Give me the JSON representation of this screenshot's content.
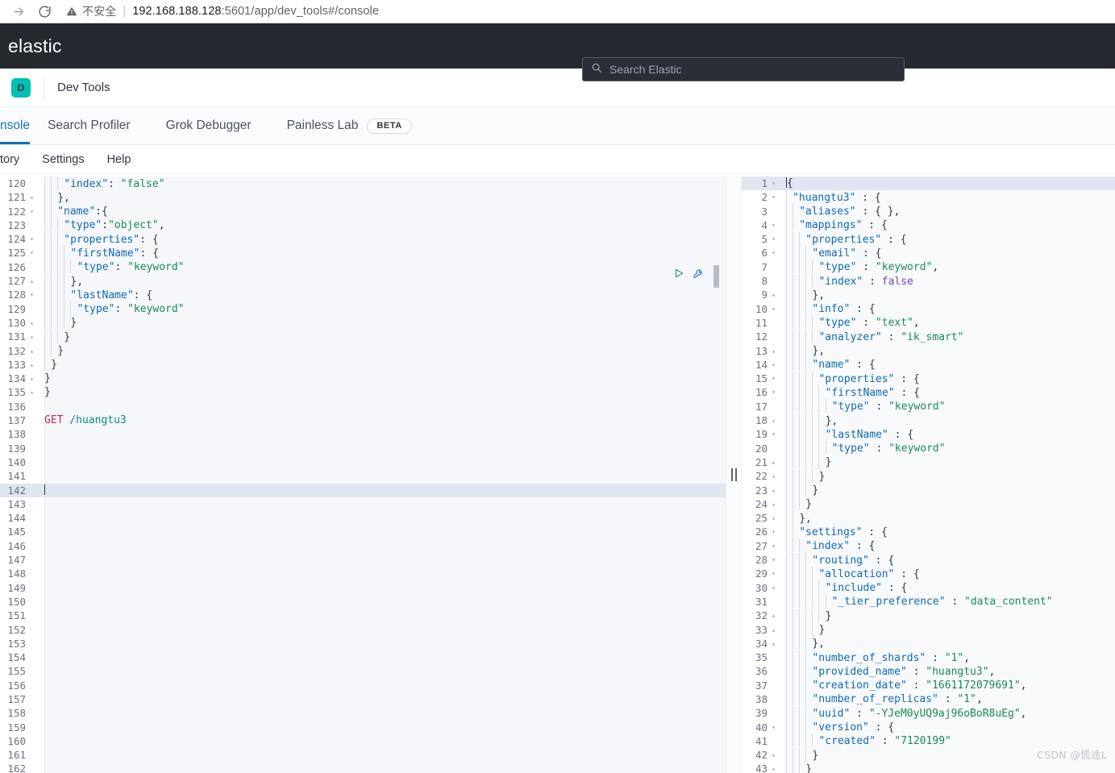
{
  "browser": {
    "forward_icon": "forward-arrow-icon",
    "reload_icon": "reload-icon",
    "security_icon": "warning-triangle-icon",
    "security_label": "不安全",
    "divider": "|",
    "url_host": "192.168.188.128",
    "url_rest": ":5601/app/dev_tools#/console"
  },
  "header": {
    "logo": "elastic",
    "search_placeholder": "Search Elastic",
    "search_value": "",
    "search_icon": "search-icon"
  },
  "app": {
    "badge": "D",
    "title": "Dev Tools"
  },
  "tabs": [
    {
      "label": "nsole",
      "full": "Console",
      "active": true,
      "beta": false
    },
    {
      "label": "Search Profiler",
      "active": false,
      "beta": false
    },
    {
      "label": "Grok Debugger",
      "active": false,
      "beta": false
    },
    {
      "label": "Painless Lab",
      "active": false,
      "beta": true,
      "beta_label": "BETA"
    }
  ],
  "submenu": [
    {
      "label": "tory",
      "full": "History"
    },
    {
      "label": "Settings"
    },
    {
      "label": "Help"
    }
  ],
  "request_editor": {
    "play_icon": "play-request-icon",
    "wrench_icon": "wrench-icon",
    "active_line": 142,
    "lines": [
      {
        "n": 120,
        "fold": "",
        "indent": 3,
        "code": "\"index\": \"false\"",
        "t": "kv_nocomma"
      },
      {
        "n": 121,
        "fold": "▴",
        "indent": 2,
        "code": "},"
      },
      {
        "n": 122,
        "fold": "▾",
        "indent": 2,
        "code": "\"name\":{"
      },
      {
        "n": 123,
        "fold": "",
        "indent": 3,
        "code": "\"type\":\"object\","
      },
      {
        "n": 124,
        "fold": "▾",
        "indent": 3,
        "code": "\"properties\": {"
      },
      {
        "n": 125,
        "fold": "▾",
        "indent": 4,
        "code": "\"firstName\": {"
      },
      {
        "n": 126,
        "fold": "",
        "indent": 5,
        "code": "\"type\": \"keyword\""
      },
      {
        "n": 127,
        "fold": "▴",
        "indent": 4,
        "code": "},"
      },
      {
        "n": 128,
        "fold": "▾",
        "indent": 4,
        "code": "\"lastName\": {"
      },
      {
        "n": 129,
        "fold": "",
        "indent": 5,
        "code": "\"type\": \"keyword\""
      },
      {
        "n": 130,
        "fold": "▴",
        "indent": 4,
        "code": "}"
      },
      {
        "n": 131,
        "fold": "▴",
        "indent": 3,
        "code": "}"
      },
      {
        "n": 132,
        "fold": "▴",
        "indent": 2,
        "code": "}"
      },
      {
        "n": 133,
        "fold": "▴",
        "indent": 1,
        "code": "}"
      },
      {
        "n": 134,
        "fold": "▴",
        "indent": 0,
        "code": "}"
      },
      {
        "n": 135,
        "fold": "▴",
        "indent": -1,
        "code": "}"
      },
      {
        "n": 136,
        "fold": "",
        "indent": -1,
        "code": ""
      },
      {
        "n": 137,
        "fold": "",
        "indent": -1,
        "code": "GET /huangtu3",
        "t": "request"
      },
      {
        "n": 138,
        "fold": "",
        "indent": -1,
        "code": ""
      },
      {
        "n": 139,
        "fold": "",
        "indent": -1,
        "code": ""
      },
      {
        "n": 140,
        "fold": "",
        "indent": -1,
        "code": ""
      },
      {
        "n": 141,
        "fold": "",
        "indent": -1,
        "code": ""
      },
      {
        "n": 142,
        "fold": "",
        "indent": -1,
        "code": "",
        "t": "cursor"
      },
      {
        "n": 143,
        "fold": "",
        "indent": -1,
        "code": ""
      },
      {
        "n": 144,
        "fold": "",
        "indent": -1,
        "code": ""
      },
      {
        "n": 145,
        "fold": "",
        "indent": -1,
        "code": ""
      },
      {
        "n": 146,
        "fold": "",
        "indent": -1,
        "code": ""
      },
      {
        "n": 147,
        "fold": "",
        "indent": -1,
        "code": ""
      },
      {
        "n": 148,
        "fold": "",
        "indent": -1,
        "code": ""
      },
      {
        "n": 149,
        "fold": "",
        "indent": -1,
        "code": ""
      },
      {
        "n": 150,
        "fold": "",
        "indent": -1,
        "code": ""
      },
      {
        "n": 151,
        "fold": "",
        "indent": -1,
        "code": ""
      },
      {
        "n": 152,
        "fold": "",
        "indent": -1,
        "code": ""
      },
      {
        "n": 153,
        "fold": "",
        "indent": -1,
        "code": ""
      },
      {
        "n": 154,
        "fold": "",
        "indent": -1,
        "code": ""
      },
      {
        "n": 155,
        "fold": "",
        "indent": -1,
        "code": ""
      },
      {
        "n": 156,
        "fold": "",
        "indent": -1,
        "code": ""
      },
      {
        "n": 157,
        "fold": "",
        "indent": -1,
        "code": ""
      },
      {
        "n": 158,
        "fold": "",
        "indent": -1,
        "code": ""
      },
      {
        "n": 159,
        "fold": "",
        "indent": -1,
        "code": ""
      },
      {
        "n": 160,
        "fold": "",
        "indent": -1,
        "code": ""
      },
      {
        "n": 161,
        "fold": "",
        "indent": -1,
        "code": ""
      },
      {
        "n": 162,
        "fold": "",
        "indent": -1,
        "code": ""
      }
    ]
  },
  "splitter": {
    "grip_icon": "drag-handle-icon"
  },
  "response_editor": {
    "active_line": 1,
    "lines": [
      {
        "n": 1,
        "fold": "▾",
        "indent": 0,
        "code": "{",
        "t": "cursor"
      },
      {
        "n": 2,
        "fold": "▾",
        "indent": 1,
        "code": "\"huangtu3\" : {"
      },
      {
        "n": 3,
        "fold": "",
        "indent": 2,
        "code": "\"aliases\" : { },"
      },
      {
        "n": 4,
        "fold": "▾",
        "indent": 2,
        "code": "\"mappings\" : {"
      },
      {
        "n": 5,
        "fold": "▾",
        "indent": 3,
        "code": "\"properties\" : {"
      },
      {
        "n": 6,
        "fold": "▾",
        "indent": 4,
        "code": "\"email\" : {"
      },
      {
        "n": 7,
        "fold": "",
        "indent": 5,
        "code": "\"type\" : \"keyword\","
      },
      {
        "n": 8,
        "fold": "",
        "indent": 5,
        "code": "\"index\" : false",
        "t": "bool"
      },
      {
        "n": 9,
        "fold": "▴",
        "indent": 4,
        "code": "},"
      },
      {
        "n": 10,
        "fold": "▾",
        "indent": 4,
        "code": "\"info\" : {"
      },
      {
        "n": 11,
        "fold": "",
        "indent": 5,
        "code": "\"type\" : \"text\","
      },
      {
        "n": 12,
        "fold": "",
        "indent": 5,
        "code": "\"analyzer\" : \"ik_smart\""
      },
      {
        "n": 13,
        "fold": "▴",
        "indent": 4,
        "code": "},"
      },
      {
        "n": 14,
        "fold": "▾",
        "indent": 4,
        "code": "\"name\" : {"
      },
      {
        "n": 15,
        "fold": "▾",
        "indent": 5,
        "code": "\"properties\" : {"
      },
      {
        "n": 16,
        "fold": "▾",
        "indent": 6,
        "code": "\"firstName\" : {"
      },
      {
        "n": 17,
        "fold": "",
        "indent": 7,
        "code": "\"type\" : \"keyword\""
      },
      {
        "n": 18,
        "fold": "▴",
        "indent": 6,
        "code": "},"
      },
      {
        "n": 19,
        "fold": "▾",
        "indent": 6,
        "code": "\"lastName\" : {"
      },
      {
        "n": 20,
        "fold": "",
        "indent": 7,
        "code": "\"type\" : \"keyword\""
      },
      {
        "n": 21,
        "fold": "▴",
        "indent": 6,
        "code": "}"
      },
      {
        "n": 22,
        "fold": "▴",
        "indent": 5,
        "code": "}"
      },
      {
        "n": 23,
        "fold": "▴",
        "indent": 4,
        "code": "}"
      },
      {
        "n": 24,
        "fold": "▴",
        "indent": 3,
        "code": "}"
      },
      {
        "n": 25,
        "fold": "▴",
        "indent": 2,
        "code": "},"
      },
      {
        "n": 26,
        "fold": "▾",
        "indent": 2,
        "code": "\"settings\" : {"
      },
      {
        "n": 27,
        "fold": "▾",
        "indent": 3,
        "code": "\"index\" : {"
      },
      {
        "n": 28,
        "fold": "▾",
        "indent": 4,
        "code": "\"routing\" : {"
      },
      {
        "n": 29,
        "fold": "▾",
        "indent": 5,
        "code": "\"allocation\" : {"
      },
      {
        "n": 30,
        "fold": "▾",
        "indent": 6,
        "code": "\"include\" : {"
      },
      {
        "n": 31,
        "fold": "",
        "indent": 7,
        "code": "\"_tier_preference\" : \"data_content\""
      },
      {
        "n": 32,
        "fold": "▴",
        "indent": 6,
        "code": "}"
      },
      {
        "n": 33,
        "fold": "▴",
        "indent": 5,
        "code": "}"
      },
      {
        "n": 34,
        "fold": "▴",
        "indent": 4,
        "code": "},"
      },
      {
        "n": 35,
        "fold": "",
        "indent": 4,
        "code": "\"number_of_shards\" : \"1\","
      },
      {
        "n": 36,
        "fold": "",
        "indent": 4,
        "code": "\"provided_name\" : \"huangtu3\","
      },
      {
        "n": 37,
        "fold": "",
        "indent": 4,
        "code": "\"creation_date\" : \"1661172079691\","
      },
      {
        "n": 38,
        "fold": "",
        "indent": 4,
        "code": "\"number_of_replicas\" : \"1\","
      },
      {
        "n": 39,
        "fold": "",
        "indent": 4,
        "code": "\"uuid\" : \"-YJeM0yUQ9aj96oBoR8uEg\","
      },
      {
        "n": 40,
        "fold": "▾",
        "indent": 4,
        "code": "\"version\" : {"
      },
      {
        "n": 41,
        "fold": "",
        "indent": 5,
        "code": "\"created\" : \"7120199\""
      },
      {
        "n": 42,
        "fold": "▴",
        "indent": 4,
        "code": "}"
      },
      {
        "n": 43,
        "fold": "▴",
        "indent": 3,
        "code": "}"
      }
    ]
  },
  "watermark": {
    "text": "CSDN @慌途L"
  },
  "colors": {
    "elastic_dark": "#25282f",
    "teal_badge": "#00BFB3",
    "tab_active_blue": "#0071c2",
    "json_key": "#0f6ab4",
    "json_string": "#1a8a5a",
    "json_bool": "#6f42c1",
    "method": "#c7254e",
    "url_path": "#0f8a84"
  }
}
